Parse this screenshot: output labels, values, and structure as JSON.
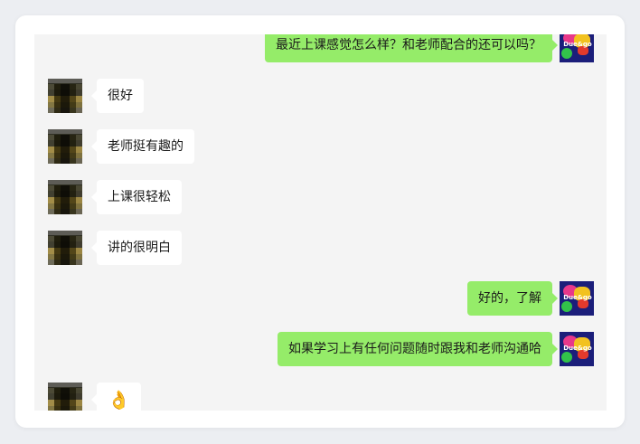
{
  "messages": [
    {
      "side": "out",
      "text": "最近上课感觉怎么样？和老师配合的还可以吗？"
    },
    {
      "side": "in",
      "text": "很好"
    },
    {
      "side": "in",
      "text": "老师挺有趣的"
    },
    {
      "side": "in",
      "text": "上课很轻松"
    },
    {
      "side": "in",
      "text": "讲的很明白"
    },
    {
      "side": "out",
      "text": "好的，了解"
    },
    {
      "side": "out",
      "text": "如果学习上有任何问题随时跟我和老师沟通哈"
    },
    {
      "side": "in",
      "text": "👌"
    }
  ],
  "avatars": {
    "self_icon": "colorful-logo-avatar",
    "self_logo_text": "Due&go",
    "other_icon": "pixelated-avatar"
  },
  "colors": {
    "outgoing_bubble": "#95ec69",
    "incoming_bubble": "#ffffff",
    "chat_background": "#f4f4f4"
  }
}
